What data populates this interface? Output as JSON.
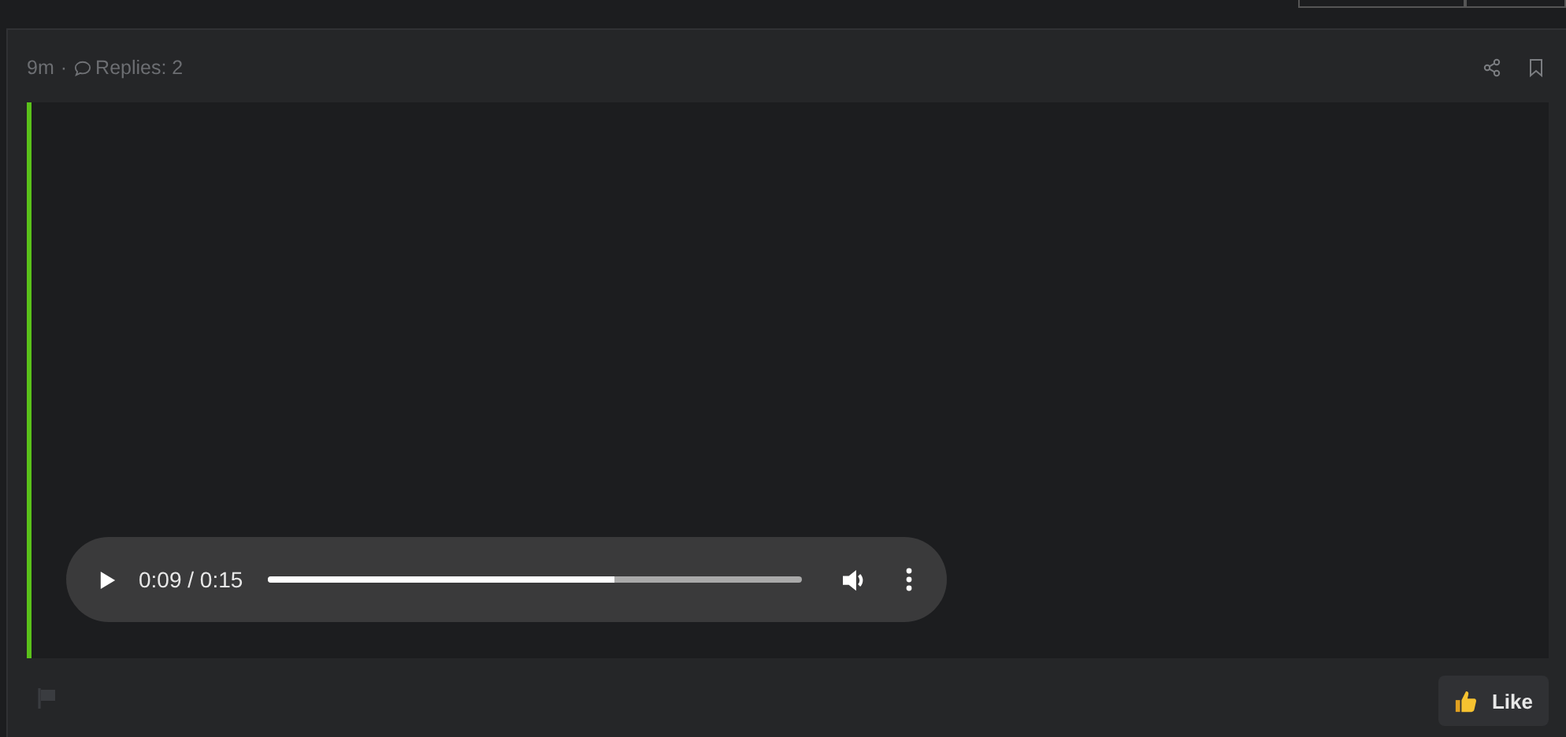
{
  "post": {
    "age": "9m",
    "separator": "·",
    "replies": "Replies: 2"
  },
  "audio": {
    "time": "0:09 / 0:15",
    "level": 0.65
  },
  "like": {
    "label": "Like"
  }
}
